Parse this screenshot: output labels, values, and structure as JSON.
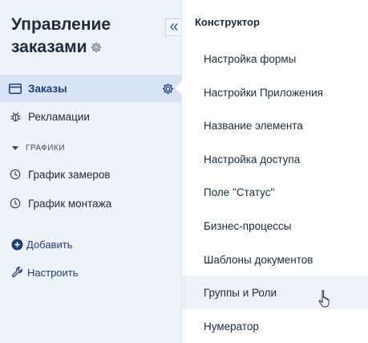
{
  "sidebar": {
    "title": "Управление заказами",
    "collapse_icon": "«",
    "items": [
      {
        "label": "Заказы",
        "icon": "card-icon",
        "active": true
      },
      {
        "label": "Рекламации",
        "icon": "bug-icon",
        "active": false
      }
    ],
    "section": {
      "label": "ГРАФИКИ",
      "items": [
        {
          "label": "График замеров",
          "icon": "clock-icon"
        },
        {
          "label": "График монтажа",
          "icon": "clock-icon"
        }
      ]
    },
    "actions": {
      "add_label": "Добавить",
      "configure_label": "Настроить"
    }
  },
  "menu": {
    "header": "Конструктор",
    "items": [
      "Настройка формы",
      "Настройки Приложения",
      "Название элемента",
      "Настройка доступа",
      "Поле \"Статус\"",
      "Бизнес-процессы",
      "Шаблоны документов",
      "Группы и Роли",
      "Нумератор"
    ],
    "hovered_item": "Группы и Роли"
  },
  "colors": {
    "sidebar_bg": "#eef2f9",
    "active_bg": "#d8e4f6",
    "accent": "#1f3e73",
    "hover_bg": "#eef1f5"
  }
}
